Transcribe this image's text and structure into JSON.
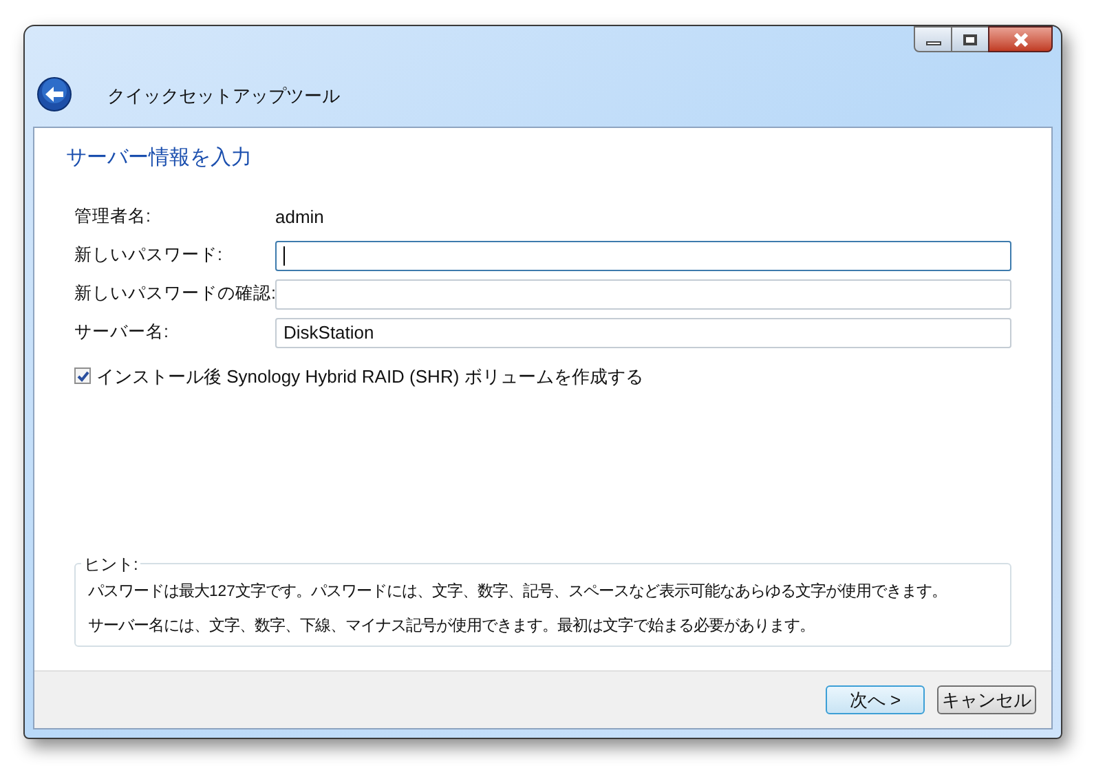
{
  "window": {
    "title": "クイックセットアップツール"
  },
  "heading": "サーバー情報を入力",
  "fields": [
    {
      "kind": "text",
      "label": "管理者名:",
      "value": "admin"
    },
    {
      "kind": "input",
      "label": "新しいパスワード:",
      "focused": true
    },
    {
      "kind": "input",
      "label": "新しいパスワードの確認:",
      "focused": false
    },
    {
      "kind": "input",
      "label": "サーバー名:",
      "value": "DiskStation",
      "focused": false
    }
  ],
  "checkbox": {
    "label": "インストール後 Synology Hybrid RAID (SHR) ボリュームを作成する",
    "checked": true
  },
  "hint": {
    "title": "ヒント:",
    "lines": [
      "パスワードは最大127文字です。パスワードには、文字、数字、記号、スペースなど表示可能なあらゆる文字が使用できます。",
      "サーバー名には、文字、数字、下線、マイナス記号が使用できます。最初は文字で始まる必要があります。"
    ]
  },
  "buttons": [
    {
      "label": "次へ >",
      "default": true
    },
    {
      "label": "キャンセル",
      "default": false
    }
  ]
}
